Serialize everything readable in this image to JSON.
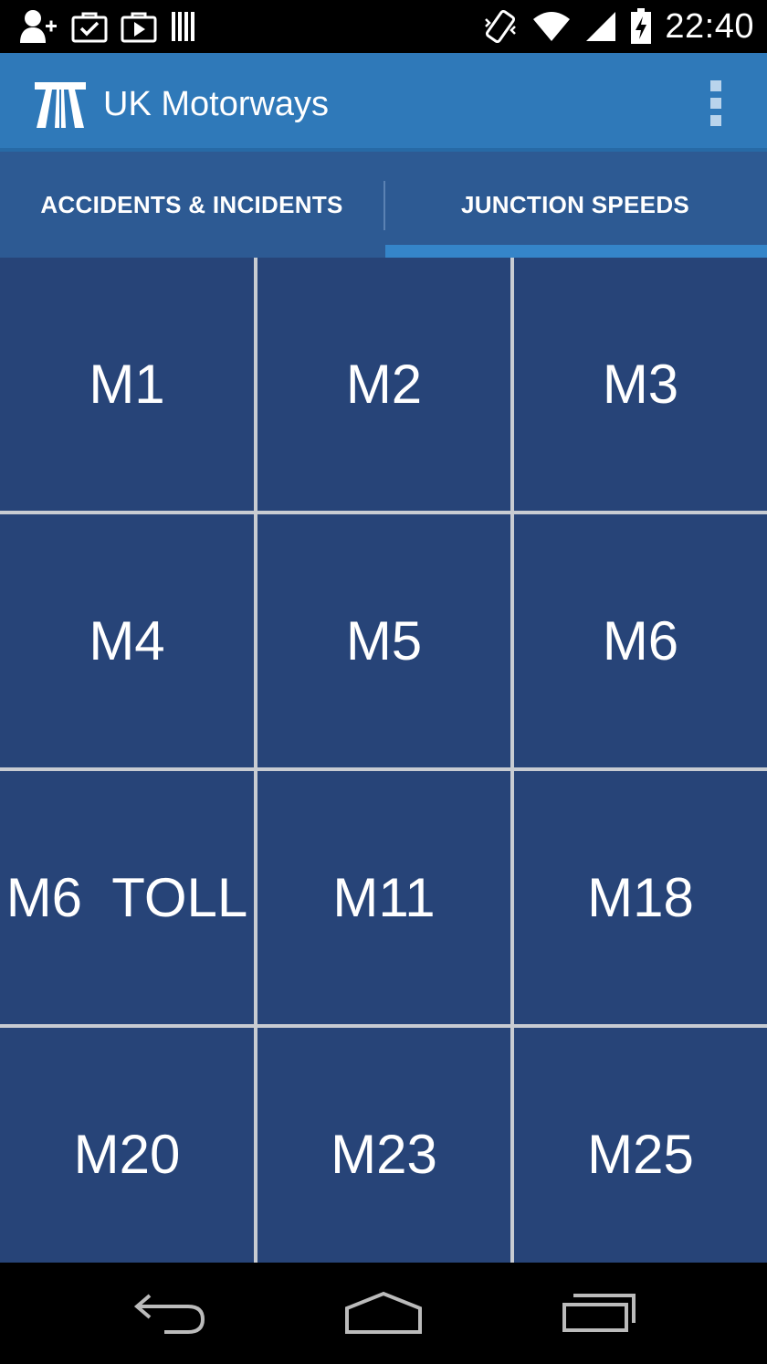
{
  "status_bar": {
    "time": "22:40",
    "left_icons": [
      "add-contact-icon",
      "briefcase-check-icon",
      "briefcase-play-icon",
      "barcode-icon"
    ],
    "right_icons": [
      "vibrate-icon",
      "wifi-icon",
      "signal-icon",
      "battery-charging-icon"
    ]
  },
  "action_bar": {
    "title": "UK Motorways",
    "logo": "motorway-icon",
    "overflow": "overflow-menu-icon",
    "color": "#2f79b9"
  },
  "tabs": [
    {
      "label": "ACCIDENTS & INCIDENTS",
      "selected": false
    },
    {
      "label": "JUNCTION SPEEDS",
      "selected": true
    }
  ],
  "motorways": [
    "M1",
    "M2",
    "M3",
    "M4",
    "M5",
    "M6",
    "M6  TOLL",
    "M11",
    "M18",
    "M20",
    "M23",
    "M25"
  ],
  "colors": {
    "tile": "#274478",
    "grid_line": "#c8ccd2",
    "tab_bar": "#2d5a93",
    "tab_indicator": "#3585c9"
  },
  "nav_bar": [
    "back-icon",
    "home-icon",
    "recent-apps-icon"
  ]
}
